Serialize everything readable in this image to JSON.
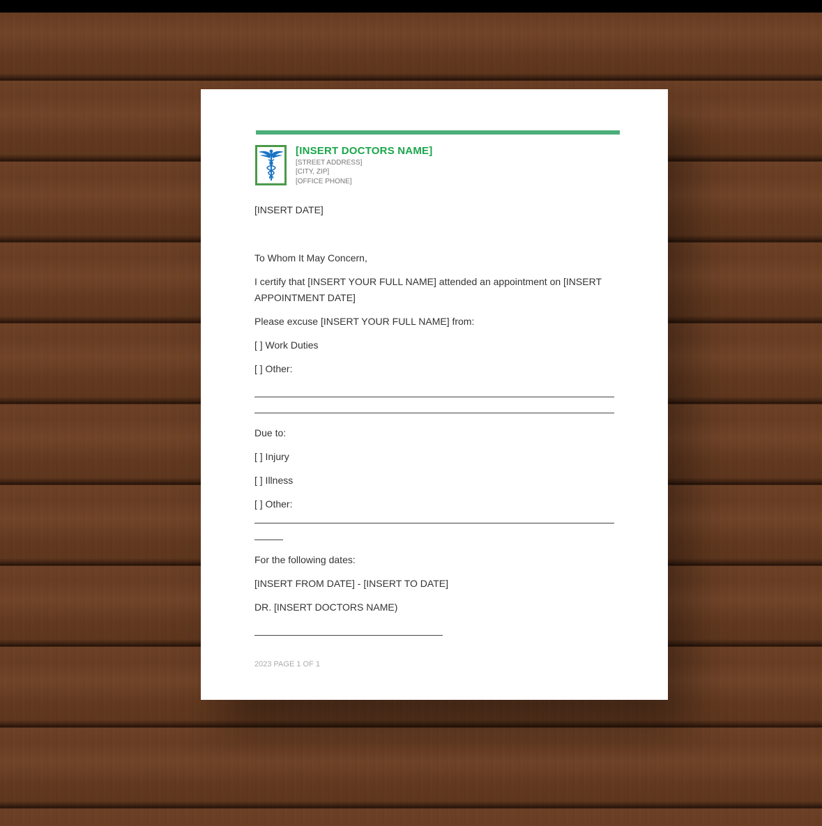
{
  "letterhead": {
    "doctor_name": "[INSERT DOCTORS NAME]",
    "street": "[STREET ADDRESS]",
    "city": "[CITY, ZIP]",
    "phone": "[OFFICE PHONE]",
    "logo_icon": "caduceus-icon",
    "accent_color": "#4cae7a",
    "name_color": "#1aa64a"
  },
  "letter": {
    "date": "[INSERT DATE]",
    "salutation": "To Whom It May Concern,",
    "certify_line1": "I certify that [INSERT YOUR FULL NAME] attended an appointment on [INSERT",
    "certify_line2": "APPOINTMENT DATE]",
    "excuse": "Please excuse [INSERT YOUR FULL NAME] from:",
    "option_work": "[ ] Work Duties",
    "option_other1": "[ ] Other:",
    "due_to": "Due to:",
    "option_injury": "[ ] Injury",
    "option_illness": "[ ] Illness",
    "option_other2": "[ ] Other:",
    "dates_label": "For the following dates:",
    "date_range": "[INSERT FROM DATE] - [INSERT TO DATE]",
    "signature_name": "DR. [INSERT DOCTORS NAME)"
  },
  "footer": {
    "page_info": "2023 PAGE 1 OF 1"
  }
}
